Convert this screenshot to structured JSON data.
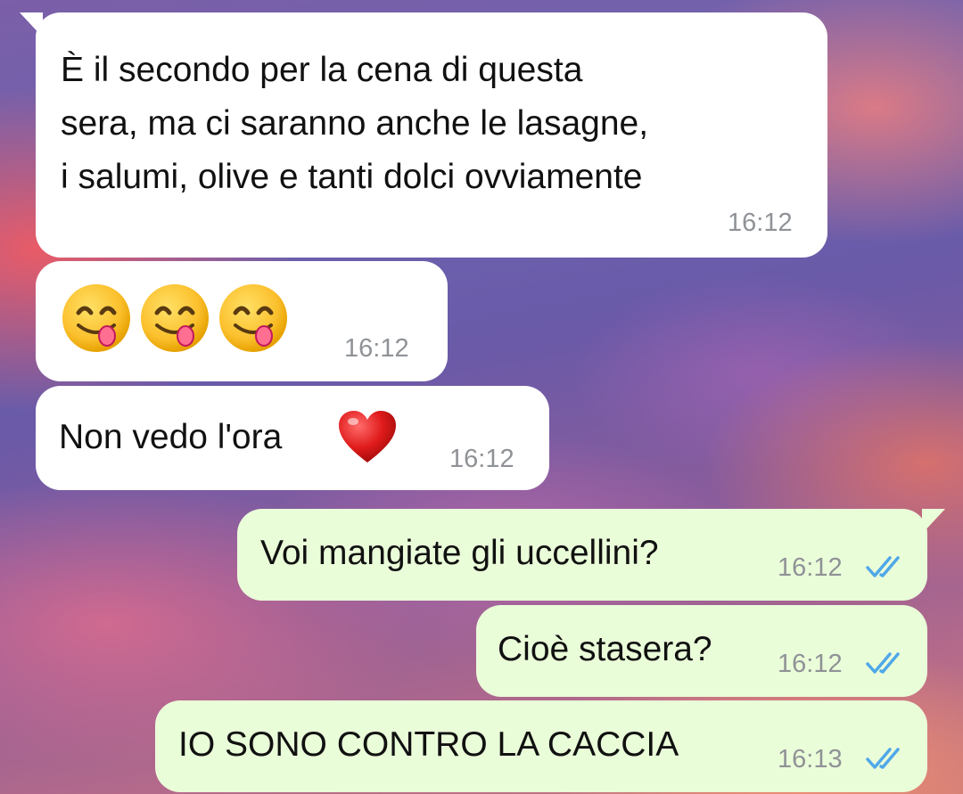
{
  "messages": [
    {
      "direction": "incoming",
      "text": "È il secondo per la cena di questa\nsera, ma ci saranno anche le lasagne,\ni salumi, olive e tanti dolci ovviamente",
      "time": "16:12"
    },
    {
      "direction": "incoming",
      "emojis": [
        "face-savoring-food-emoji",
        "face-savoring-food-emoji",
        "face-savoring-food-emoji"
      ],
      "time": "16:12"
    },
    {
      "direction": "incoming",
      "text": "Non vedo l'ora",
      "emoji": "red-heart-emoji",
      "time": "16:12"
    },
    {
      "direction": "outgoing",
      "text": "Voi mangiate gli uccellini?",
      "time": "16:12",
      "status": "read"
    },
    {
      "direction": "outgoing",
      "text": "Cioè stasera?",
      "time": "16:12",
      "status": "read"
    },
    {
      "direction": "outgoing",
      "text": "IO SONO CONTRO LA CACCIA",
      "time": "16:13",
      "status": "read"
    }
  ],
  "colors": {
    "incoming_bubble": "#ffffff",
    "outgoing_bubble": "#eafdd9",
    "timestamp": "#8f9296",
    "read_ticks": "#4fa8e8"
  }
}
